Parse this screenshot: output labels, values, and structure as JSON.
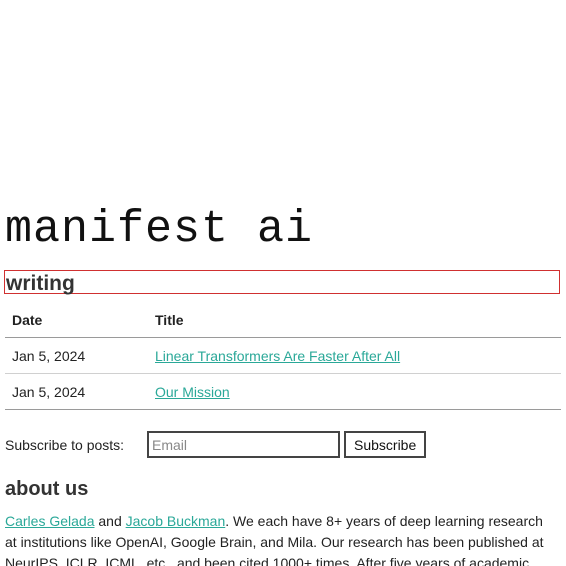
{
  "header": {
    "logo_text": "manifest ai"
  },
  "writing": {
    "heading": "writing",
    "columns": [
      "Date",
      "Title"
    ],
    "posts": [
      {
        "date": "Jan 5, 2024",
        "title": "Linear Transformers Are Faster After All"
      },
      {
        "date": "Jan 5, 2024",
        "title": "Our Mission"
      }
    ]
  },
  "subscribe": {
    "label": "Subscribe to posts:",
    "email_placeholder": "Email",
    "email_value": "",
    "button_label": "Subscribe"
  },
  "about": {
    "heading": "about us",
    "author_1": "Carles Gelada",
    "and_text": " and ",
    "author_2": "Jacob Buckman",
    "body": ". We each have 8+ years of deep learning research at institutions like OpenAI, Google Brain, and Mila. Our research has been published at NeurIPS, ICLR, ICML, etc., and been cited 1000+ times. After five years of academic"
  },
  "colors": {
    "link": "#2aa898",
    "focus_outline": "#d03030",
    "text": "#222222"
  }
}
